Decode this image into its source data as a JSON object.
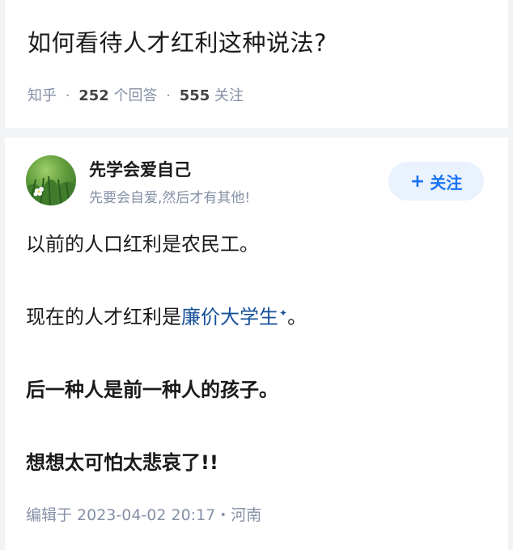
{
  "question": {
    "title": "如何看待人才红利这种说法?",
    "source": "知乎",
    "separator": "·",
    "answers_count": "252",
    "answers_unit": "个回答",
    "followers_count": "555",
    "followers_unit": "关注"
  },
  "answer": {
    "author_name": "先学会爱自己",
    "author_bio": "先要会自爱,然后才有其他!",
    "follow_label": "关注",
    "follow_plus": "+",
    "paragraphs": {
      "p1": "以前的人口红利是农民工。",
      "p2_prefix": "现在的人才红利是",
      "p2_link": "廉价大学生",
      "p2_suffix": "。",
      "p3": "后一种人是前一种人的孩子。",
      "p4": "想想太可怕太悲哀了!!"
    },
    "edit_info": "编辑于 2023-04-02 20:17・河南"
  },
  "colors": {
    "link": "#175199",
    "accent": "#1772f6",
    "meta_gray": "#8590a6"
  }
}
